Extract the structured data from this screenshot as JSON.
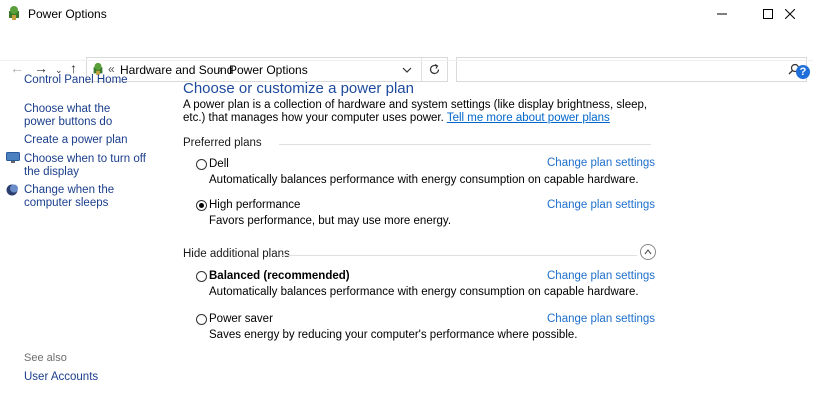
{
  "window": {
    "title": "Power Options"
  },
  "address": {
    "overflow": "«",
    "crumbs": [
      "Hardware and Sound",
      "Power Options"
    ],
    "separator": "›",
    "search_placeholder": ""
  },
  "sidebar": {
    "home": "Control Panel Home",
    "items": [
      "Choose what the power buttons do",
      "Create a power plan",
      "Choose when to turn off the display",
      "Change when the computer sleeps"
    ],
    "see_also": "See also",
    "user_accounts": "User Accounts"
  },
  "main": {
    "heading": "Choose or customize a power plan",
    "description": "A power plan is a collection of hardware and system settings (like display brightness, sleep, etc.) that manages how your computer uses power.",
    "learn_more": "Tell me more about power plans",
    "preferred_label": "Preferred plans",
    "hide_label": "Hide additional plans",
    "change_label": "Change plan settings",
    "plans": [
      {
        "name": "Dell",
        "desc": "Automatically balances performance with energy consumption on capable hardware.",
        "selected": false,
        "bold": false
      },
      {
        "name": "High performance",
        "desc": "Favors performance, but may use more energy.",
        "selected": true,
        "bold": false
      },
      {
        "name": "Balanced (recommended)",
        "desc": "Automatically balances performance with energy consumption on capable hardware.",
        "selected": false,
        "bold": true
      },
      {
        "name": "Power saver",
        "desc": "Saves energy by reducing your computer's performance where possible.",
        "selected": false,
        "bold": false
      }
    ]
  },
  "colors": {
    "link": "#1e6fcc",
    "heading": "#1e4a9e"
  }
}
